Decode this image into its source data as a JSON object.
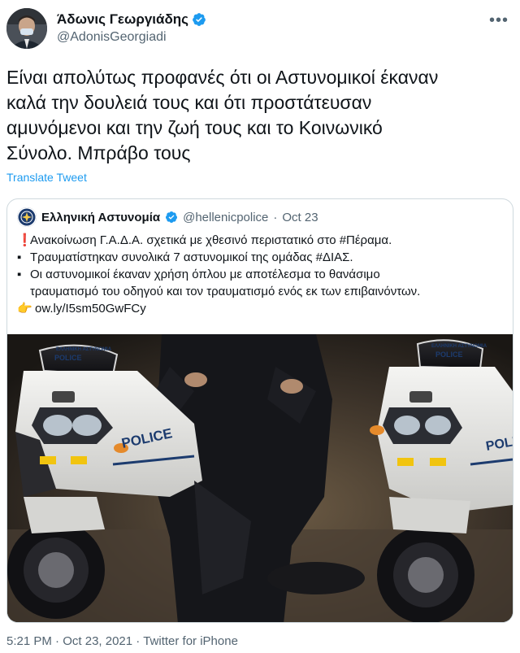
{
  "author": {
    "display_name": "Άδωνις Γεωργιάδης",
    "handle": "@AdonisGeorgiadi"
  },
  "tweet": {
    "text_lines": [
      "Είναι απολύτως προφανές ότι οι Αστυνομικοί έκαναν",
      "καλά την δουλειά τους και ότι προστάτευσαν",
      "αμυνόμενοι και την ζωή τους και το Κοινωνικό",
      "Σύνολο. Μπράβο τους"
    ],
    "translate_label": "Translate Tweet"
  },
  "quoted": {
    "display_name": "Ελληνική Αστυνομία",
    "handle": "@hellenicpolice",
    "separator": "·",
    "date": "Oct 23",
    "lines": [
      {
        "bullet": "❗",
        "text": "Ανακοίνωση Γ.Α.Δ.Α. σχετικά με χθεσινό περιστατικό στο #Πέραμα."
      },
      {
        "bullet": "▪",
        "text": "Τραυματίστηκαν συνολικά 7 αστυνομικοί της ομάδας #ΔΙΑΣ."
      },
      {
        "bullet": "▪",
        "text": "Οι αστυνομικοί έκαναν χρήση όπλου με αποτέλεσμα το θανάσιμο"
      },
      {
        "bullet": "",
        "text": "τραυματισμό του οδηγού και τον τραυματισμό ενός εκ των επιβαινόντων."
      },
      {
        "bullet": "👉",
        "text": "ow.ly/I5sm50GwFCy"
      }
    ],
    "photo": {
      "windshield_left": "ΕΛΛΗΝΙΚΗ ΑΣΤΥΝΟΜΙΑ",
      "windshield_right": "ΕΛΛΗΝΙΚΗ ΑΣΤΥΝΟΜΙΑ",
      "police_top_left": "POLICE",
      "police_top_right": "POLICE",
      "police_side_left": "POLICE",
      "police_side_right": "POLI"
    }
  },
  "footer": {
    "time": "5:21 PM",
    "separator": "·",
    "date": "Oct 23, 2021",
    "source": "Twitter for iPhone"
  },
  "colors": {
    "link": "#1d9bf0",
    "verified": "#1d9bf0",
    "secondary_text": "#536471",
    "border": "#cfd9de"
  },
  "icons": {
    "verified": "verified-badge-icon",
    "more": "more-options-icon"
  }
}
